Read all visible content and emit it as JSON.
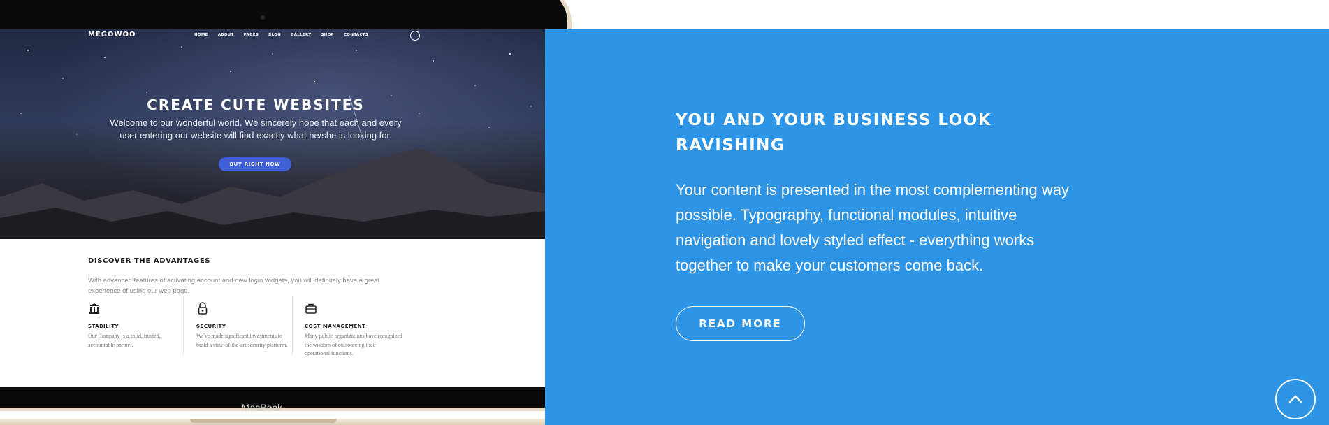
{
  "section": {
    "headline": "YOU AND YOUR BUSINESS LOOK RAVISHING",
    "body": "Your content is presented in the most complementing way possible. Typography, functional modules, intuitive navigation and lovely styled effect - everything works together to make your customers come back.",
    "cta_label": "READ MORE",
    "background_color": "#2d94e6"
  },
  "laptop": {
    "label": "MacBook",
    "screen": {
      "logo": "MEGOWOO",
      "nav": [
        "HOME",
        "ABOUT",
        "PAGES",
        "BLOG",
        "GALLERY",
        "SHOP",
        "CONTACTS"
      ],
      "user_icon": "user-icon",
      "hero_title": "CREATE CUTE WEBSITES",
      "hero_subtitle": "Welcome to our wonderful world. We sincerely hope that each and every user entering our website will find exactly what he/she is looking for.",
      "hero_button": "BUY RIGHT NOW",
      "advantages_title": "DISCOVER THE ADVANTAGES",
      "advantages_desc": "With advanced features of activating account and new login widgets, you will definitely have a great experience of using our web page.",
      "features": [
        {
          "icon": "bank-icon",
          "name": "STABILITY",
          "desc": "Our Company is a solid, trusted, accountable partner."
        },
        {
          "icon": "lock-icon",
          "name": "SECURITY",
          "desc": "We've made significant investments to build a state-of-the-art security platform."
        },
        {
          "icon": "briefcase-icon",
          "name": "COST MANAGEMENT",
          "desc": "Many public organizations have recognized the wisdom of outsourcing their operational functions."
        }
      ]
    }
  },
  "scroll_top_icon": "chevron-up-icon"
}
